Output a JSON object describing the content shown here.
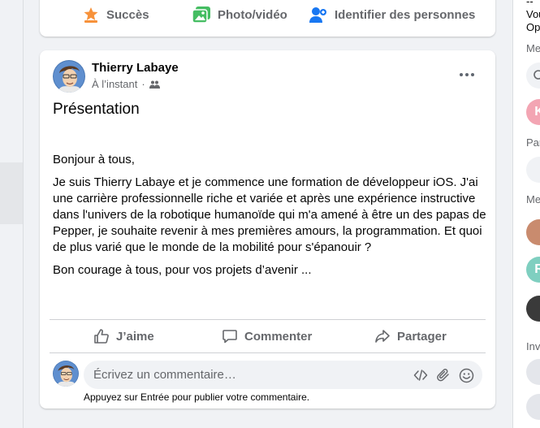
{
  "composer": {
    "success_label": "Succès",
    "photo_label": "Photo/vidéo",
    "tag_label": "Identifier des personnes"
  },
  "post": {
    "author": "Thierry Labaye",
    "time": "À l’instant",
    "title": "Présentation",
    "paragraphs": [
      "Bonjour à tous,",
      "Je suis Thierry Labaye et je commence une formation de développeur iOS. J'ai une carrière professionnelle riche et variée et après une expérience instructive dans l'univers de la robotique humanoïde qui m'a amené à être un des papas de Pepper, je souhaite revenir à mes premières amours, la programmation. Et quoi de plus varié que le monde de la mobilité pour s'épanouir ?",
      "Bon courage à tous, pour vos projets d’avenir ..."
    ],
    "actions": {
      "like": "J’aime",
      "comment": "Commenter",
      "share": "Partager"
    },
    "comment_placeholder": "Écrivez un commentaire…",
    "comment_hint": "Appuyez sur Entrée pour publier votre commentaire."
  },
  "right_column": {
    "line1": "--",
    "line2": "Vou",
    "line3": "Op",
    "label_me1": "Me",
    "label_par": "Par",
    "label_me2": "Me",
    "label_inv": "Inv",
    "k_initial": "K",
    "r_initial": "R"
  },
  "colors": {
    "accent": "#1877f2",
    "success_orange": "#f7923b",
    "photo_green": "#45bd62",
    "text_secondary": "#65676b"
  }
}
